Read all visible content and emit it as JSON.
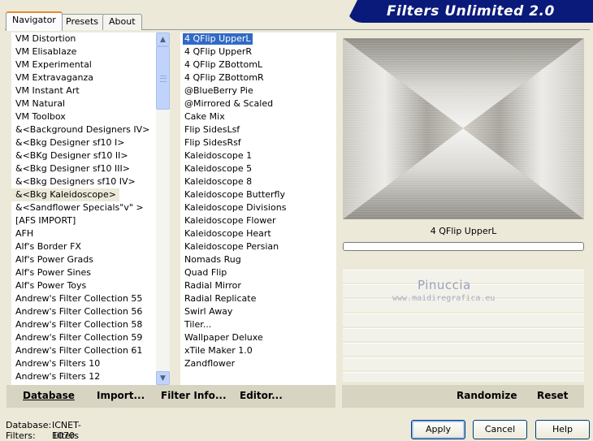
{
  "app": {
    "title": "Filters Unlimited 2.0"
  },
  "tabs": [
    {
      "label": "Navigator",
      "active": true
    },
    {
      "label": "Presets",
      "active": false
    },
    {
      "label": "About",
      "active": false
    }
  ],
  "categories": {
    "items": [
      "VM Distortion",
      "VM Elisablaze",
      "VM Experimental",
      "VM Extravaganza",
      "VM Instant Art",
      "VM Natural",
      "VM Toolbox",
      "&<Background Designers IV>",
      "&<Bkg Designer sf10 I>",
      "&<BKg Designer sf10 II>",
      "&<Bkg Designer sf10 III>",
      "&<Bkg Designers sf10 IV>",
      "&<Bkg Kaleidoscope>",
      "&<Sandflower Specials\"v\" >",
      "[AFS IMPORT]",
      "AFH",
      "Alf's Border FX",
      "Alf's Power Grads",
      "Alf's Power Sines",
      "Alf's Power Toys",
      "Andrew's Filter Collection 55",
      "Andrew's Filter Collection 56",
      "Andrew's Filter Collection 58",
      "Andrew's Filter Collection 59",
      "Andrew's Filter Collection 61",
      "Andrew's Filters 10",
      "Andrew's Filters 12"
    ],
    "selected_index": 12
  },
  "filters": {
    "items": [
      "4 QFlip UpperL",
      "4 QFlip UpperR",
      "4 QFlip ZBottomL",
      "4 QFlip ZBottomR",
      "@BlueBerry Pie",
      "@Mirrored & Scaled",
      "Cake Mix",
      "Flip SidesLsf",
      "Flip SidesRsf",
      "Kaleidoscope 1",
      "Kaleidoscope 5",
      "Kaleidoscope 8",
      "Kaleidoscope Butterfly",
      "Kaleidoscope Divisions",
      "Kaleidoscope Flower",
      "Kaleidoscope Heart",
      "Kaleidoscope Persian",
      "Nomads Rug",
      "Quad Flip",
      "Radial Mirror",
      "Radial Replicate",
      "Swirl Away",
      "Tiler...",
      "Wallpaper Deluxe",
      "xTile Maker 1.0",
      "Zandflower"
    ],
    "selected_index": 0
  },
  "preview": {
    "filter_name": "4 QFlip UpperL",
    "progress": 0
  },
  "watermark": {
    "name": "Pinuccia",
    "url": "www.maidiregrafica.eu"
  },
  "toolbar": {
    "database": "Database",
    "import": "Import...",
    "filter_info": "Filter Info...",
    "editor": "Editor...",
    "randomize": "Randomize",
    "reset": "Reset"
  },
  "status": {
    "database_label": "Database:",
    "database_value": "ICNET-Filters",
    "filters_label": "Filters:",
    "filters_value": "1070"
  },
  "buttons": {
    "apply": "Apply",
    "cancel": "Cancel",
    "help": "Help"
  },
  "colors": {
    "banner": "#0a1a7a",
    "selection": "#316ac5",
    "dialog_bg": "#ece9d8"
  }
}
